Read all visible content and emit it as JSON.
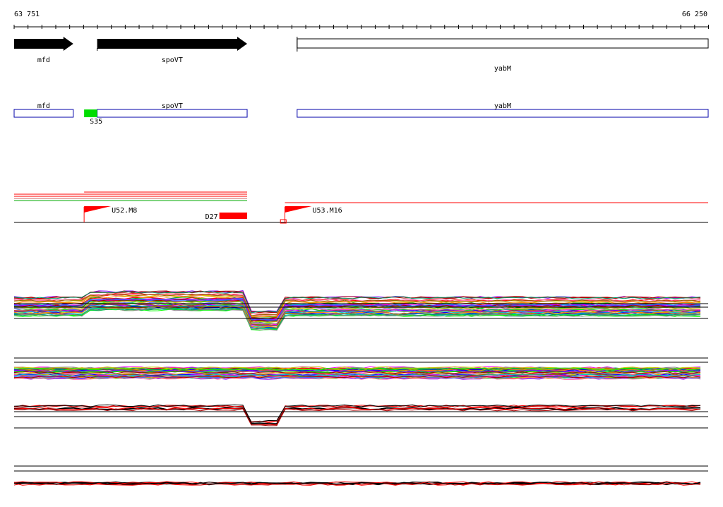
{
  "ruler": {
    "start_label": "63 751",
    "end_label": "66 250",
    "start": 63751,
    "end": 66250
  },
  "genes": [
    {
      "name": "mfd",
      "start": 63751,
      "end": 63964,
      "strand": "+"
    },
    {
      "name": "spoVT",
      "start": 64050,
      "end": 64590,
      "strand": "+"
    },
    {
      "name": "yabM",
      "start": 64770,
      "end": 66250,
      "strand": "none"
    }
  ],
  "annotations": [
    {
      "name": "mfd",
      "start": 63751,
      "end": 63964
    },
    {
      "name": "spoVT",
      "start": 64050,
      "end": 64590
    },
    {
      "name": "yabM",
      "start": 64770,
      "end": 66250
    }
  ],
  "promoter_feature": {
    "label": "S35",
    "start": 64003,
    "end": 64050,
    "color": "#00dd00"
  },
  "tus": [
    {
      "label": "U52.M8",
      "position": 64003
    },
    {
      "label": "U53.M16",
      "position": 64726
    }
  ],
  "terminator": {
    "label": "D27",
    "start": 64490,
    "end": 64590,
    "color": "#ff0000"
  },
  "colors": {
    "gene_arrow": "#000000",
    "annotation_box": "#0000aa",
    "tu_flag": "#ff0000",
    "track_red": "#ff0000"
  }
}
